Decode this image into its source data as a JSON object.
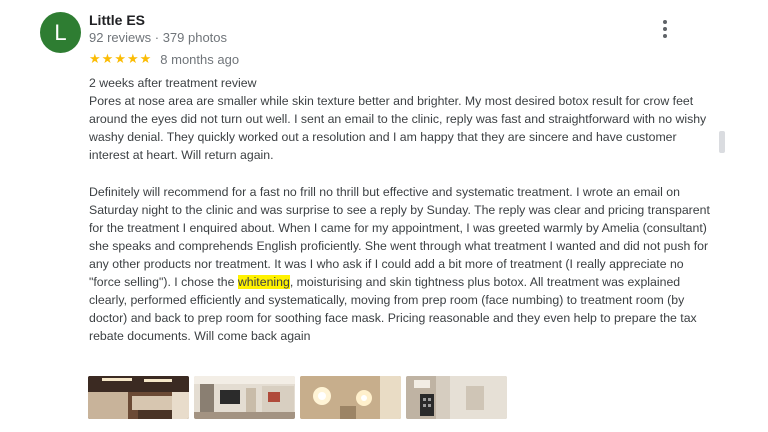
{
  "author": {
    "initial": "L",
    "name": "Little ES",
    "meta": "92 reviews · 379 photos",
    "avatar_color": "#2e7d32"
  },
  "rating": {
    "stars": 5,
    "max_stars": 5,
    "star_color": "#fbbc04",
    "age": "8 months ago"
  },
  "review": {
    "heading": "2 weeks after treatment review",
    "para1": "Pores at nose area are smaller while skin texture better and brighter. My most desired botox result for crow feet around the eyes did not turn out well. I sent an email to the clinic, reply was fast and straightforward with no wishy washy denial. They quickly worked out a resolution and I am happy that they are sincere and have customer interest at heart. Will return again.",
    "para2_before": "Definitely will recommend for a fast no frill no thrill but effective and systematic treatment. I wrote an email on Saturday night  to the clinic and was surprise to see a reply by Sunday. The reply was clear and pricing transparent for the treatment I enquired about. When I came for my appointment, I was greeted warmly by Amelia (consultant) she speaks and comprehends English proficiently. She went through what treatment I wanted and did not push for any other products nor treatment. It was I who ask if I could add a bit more of treatment (I really appreciate no \"force selling\"). I chose the ",
    "para2_highlight": "whitening",
    "highlight_color": "#fff200",
    "para2_after": ", moisturising and skin tightness plus botox. All treatment was explained clearly, performed efficiently and systematically, moving from prep room (face numbing) to treatment room (by doctor) and back to prep room for soothing face mask. Pricing reasonable and they even help to prepare the tax rebate documents. Will come back again"
  },
  "photos": [
    {
      "name": "clinic-reception-photo"
    },
    {
      "name": "clinic-waiting-area-photo"
    },
    {
      "name": "clinic-lights-photo"
    },
    {
      "name": "clinic-door-panel-photo"
    }
  ],
  "icons": {
    "more_options": "more-vert-icon",
    "star": "star-icon"
  }
}
